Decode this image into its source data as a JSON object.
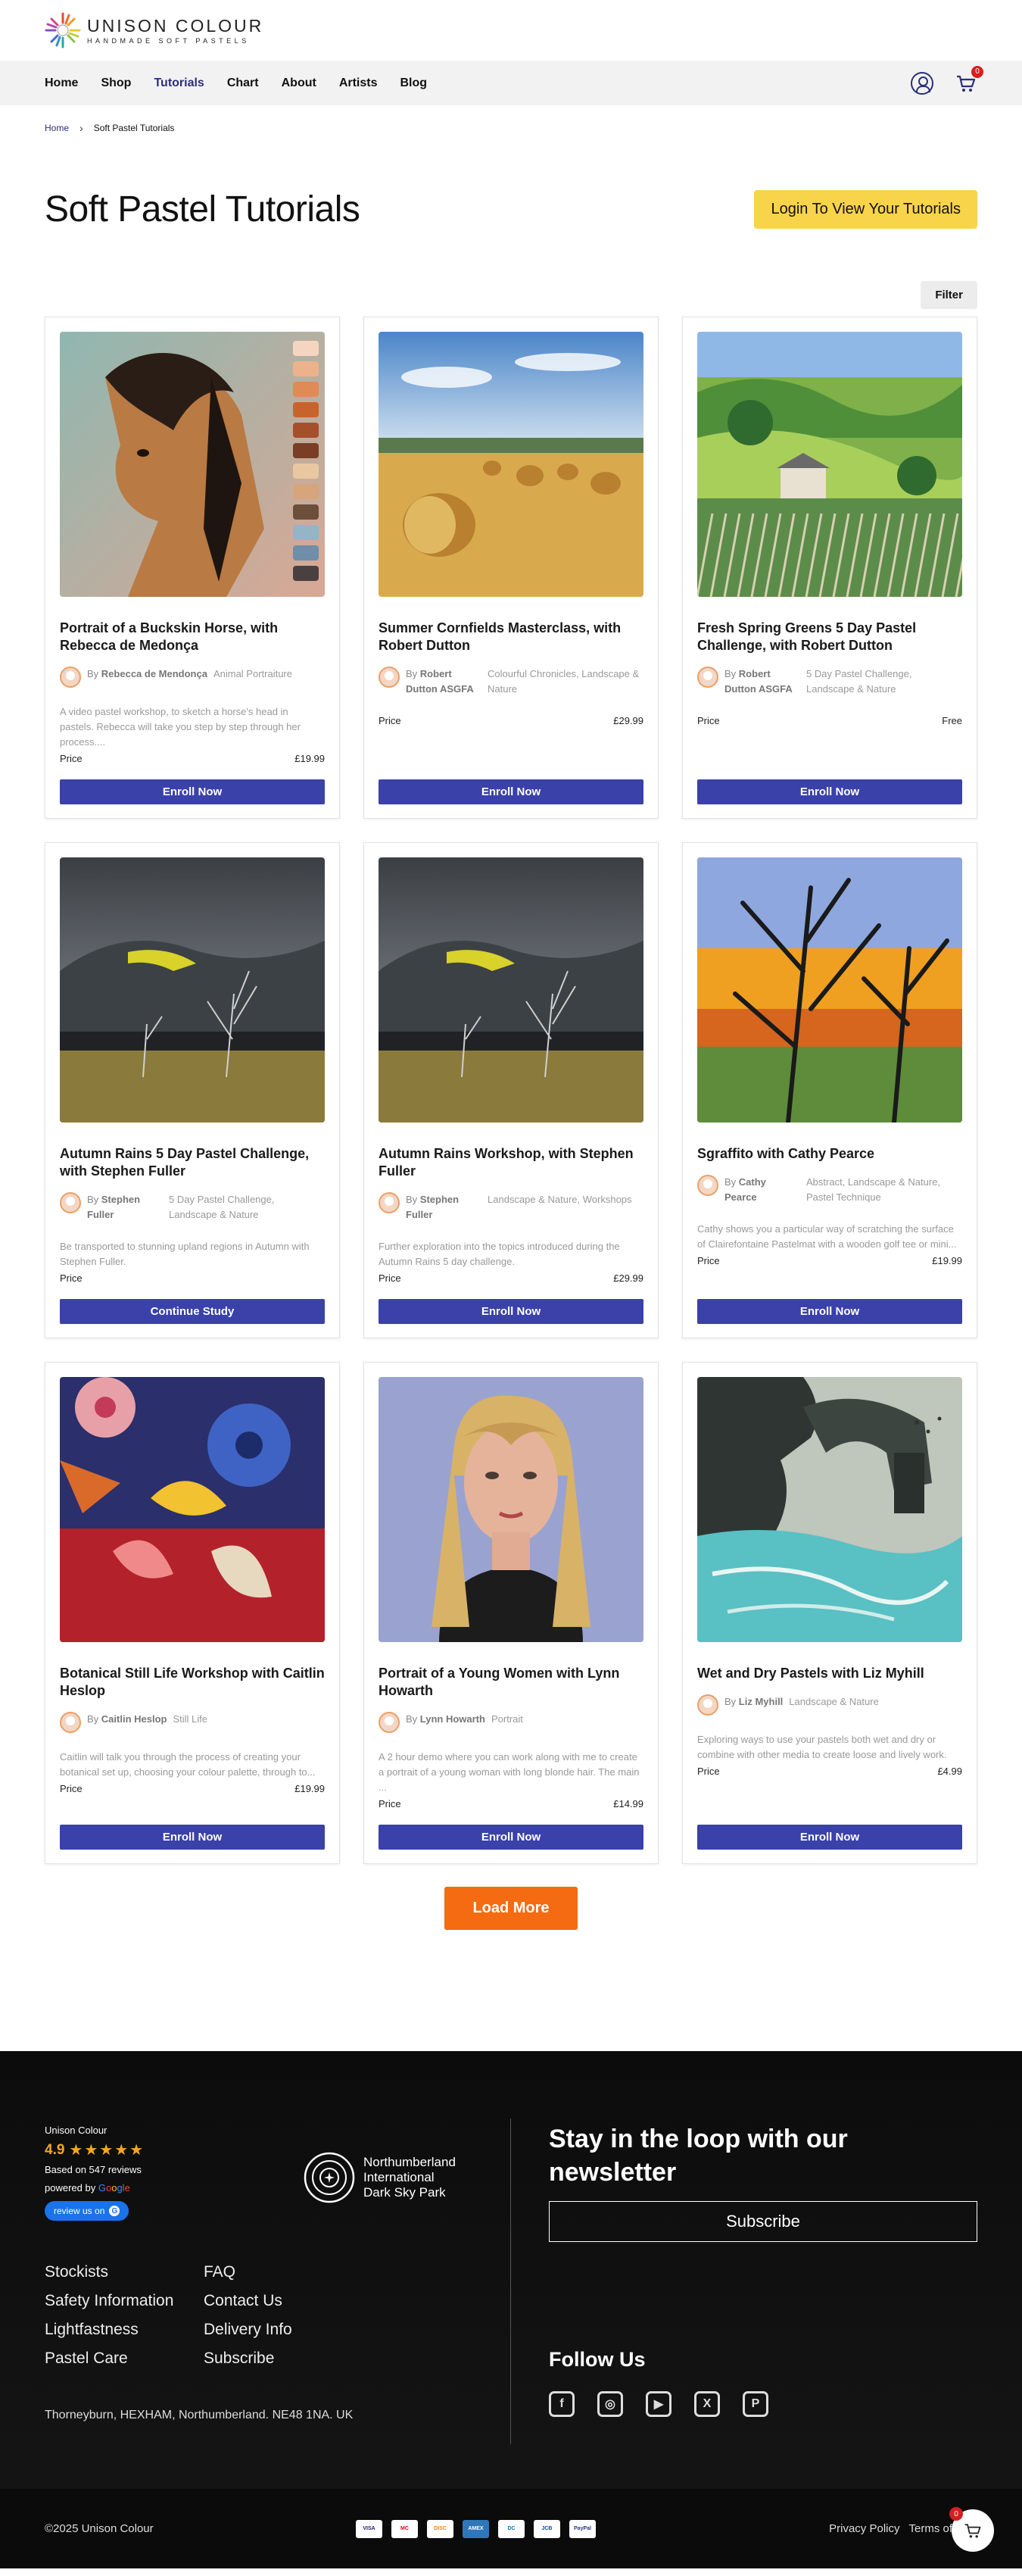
{
  "brand": {
    "name": "UNISON COLOUR",
    "tagline": "HANDMADE SOFT PASTELS"
  },
  "nav": {
    "items": [
      "Home",
      "Shop",
      "Tutorials",
      "Chart",
      "About",
      "Artists",
      "Blog"
    ],
    "active": "Tutorials",
    "cart_count": "0"
  },
  "breadcrumb": {
    "home": "Home",
    "current": "Soft Pastel Tutorials"
  },
  "page": {
    "title": "Soft Pastel Tutorials",
    "login_label": "Login To View Your Tutorials",
    "filter_label": "Filter",
    "load_more_label": "Load More",
    "price_label": "Price"
  },
  "cards": [
    {
      "title": "Portrait of a Buckskin Horse, with Rebecca de Medonça",
      "by": "By",
      "author": "Rebecca de Mendonça",
      "category": "Animal Portraiture",
      "desc": "A video pastel workshop, to sketch a horse's head in pastels. Rebecca will take you step by step through her process....",
      "price": "£19.99",
      "button": "Enroll Now",
      "image": "horse-painting-icon"
    },
    {
      "title": "Summer Cornfields Masterclass, with Robert Dutton",
      "by": "By",
      "author": "Robert Dutton ASGFA",
      "category": "Colourful Chronicles, Landscape & Nature",
      "desc": "",
      "price": "£29.99",
      "button": "Enroll Now",
      "image": "haybales-photo-icon"
    },
    {
      "title": "Fresh Spring Greens 5 Day Pastel Challenge, with Robert Dutton",
      "by": "By",
      "author": "Robert Dutton ASGFA",
      "category": "5 Day Pastel Challenge, Landscape & Nature",
      "desc": "",
      "price": "Free",
      "button": "Enroll Now",
      "image": "valley-painting-icon"
    },
    {
      "title": "Autumn Rains 5 Day Pastel Challenge, with Stephen Fuller",
      "by": "By",
      "author": "Stephen Fuller",
      "category": "5 Day Pastel Challenge, Landscape & Nature",
      "desc": "Be transported to stunning upland regions in Autumn with Stephen Fuller.",
      "price": "",
      "button": "Continue Study",
      "image": "autumn-rains-painting-icon"
    },
    {
      "title": "Autumn Rains Workshop, with Stephen Fuller",
      "by": "By",
      "author": "Stephen Fuller",
      "category": "Landscape & Nature, Workshops",
      "desc": "Further exploration into the topics introduced during the Autumn Rains 5 day challenge.",
      "price": "£29.99",
      "button": "Enroll Now",
      "image": "autumn-rains-painting-icon"
    },
    {
      "title": "Sgraffito with Cathy Pearce",
      "by": "By",
      "author": "Cathy Pearce",
      "category": "Abstract, Landscape & Nature, Pastel Technique",
      "desc": "Cathy shows you a particular way of scratching the surface of Clairefontaine Pastelmat with a wooden golf tee or mini...",
      "price": "£19.99",
      "button": "Enroll Now",
      "image": "sgraffito-painting-icon"
    },
    {
      "title": "Botanical Still Life Workshop with Caitlin Heslop",
      "by": "By",
      "author": "Caitlin Heslop",
      "category": "Still Life",
      "desc": "Caitlin will talk you through the process of creating your botanical set up, choosing your colour palette, through to...",
      "price": "£19.99",
      "button": "Enroll Now",
      "image": "botanical-painting-icon"
    },
    {
      "title": "Portrait of a Young Women with Lynn Howarth",
      "by": "By",
      "author": "Lynn Howarth",
      "category": "Portrait",
      "desc": "A 2 hour demo where you can work along with me to create a portrait of a young woman with long blonde hair. The main ...",
      "price": "£14.99",
      "button": "Enroll Now",
      "image": "portrait-painting-icon"
    },
    {
      "title": "Wet and Dry Pastels with Liz Myhill",
      "by": "By",
      "author": "Liz Myhill",
      "category": "Landscape & Nature",
      "desc": "Exploring ways to use your pastels both wet and dry or combine with other media to create loose and lively work.",
      "price": "£4.99",
      "button": "Enroll Now",
      "image": "coastal-arch-painting-icon"
    }
  ],
  "footer": {
    "review_name": "Unison Colour",
    "rating": "4.9",
    "based_on": "Based on 547 reviews",
    "powered_by": "powered by",
    "review_button": "review us on",
    "darksky": [
      "Northumberland",
      "International",
      "Dark Sky Park"
    ],
    "links": [
      "Stockists",
      "FAQ",
      "Safety Information",
      "Contact Us",
      "Lightfastness",
      "Delivery Info",
      "Pastel Care",
      "Subscribe"
    ],
    "address": "Thorneyburn, HEXHAM, Northumberland. NE48 1NA. UK",
    "newsletter_title": "Stay in the loop with our newsletter",
    "subscribe_label": "Subscribe",
    "follow_title": "Follow Us",
    "socials": [
      "facebook-icon",
      "instagram-icon",
      "youtube-icon",
      "x-icon",
      "pinterest-icon"
    ],
    "copyright": "©2025 Unison Colour",
    "payments": [
      "VISA",
      "MC",
      "DISC",
      "AMEX",
      "DC",
      "JCB",
      "PayPal"
    ],
    "privacy": "Privacy Policy",
    "terms": "Terms of",
    "float_cart_count": "0"
  },
  "colors": {
    "accent": "#3a41a8",
    "login": "#f8d44a",
    "load_more": "#f46b12",
    "nav_active": "#2b2f7a"
  }
}
